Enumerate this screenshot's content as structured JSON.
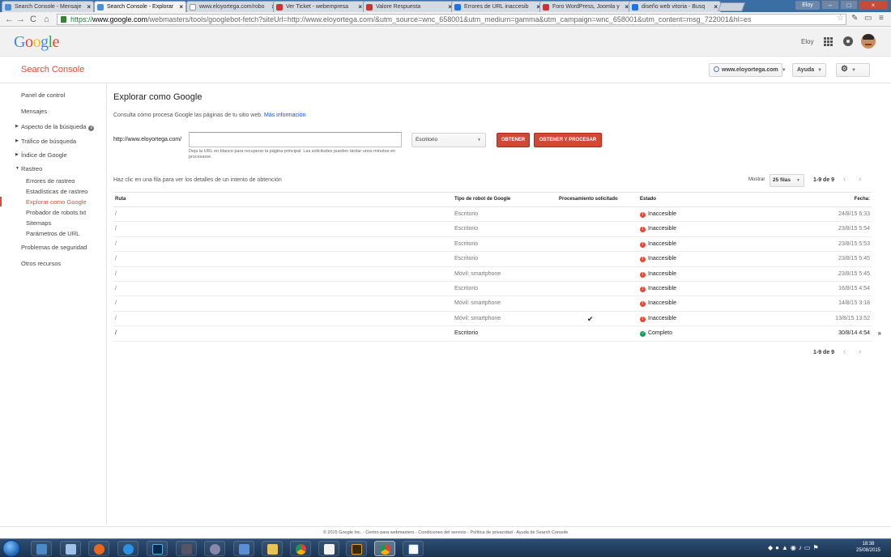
{
  "browser": {
    "tabs": [
      {
        "label": "Search Console - Mensaje"
      },
      {
        "label": "Search Console - Explorar"
      },
      {
        "label": "www.eloyortega.com/robo"
      },
      {
        "label": "Ver Ticket - webempresa"
      },
      {
        "label": "Valore Respuesta"
      },
      {
        "label": "Errores de URL inaccesib"
      },
      {
        "label": "Foro WordPress, Joomla y"
      },
      {
        "label": "diseño web vitoria - Busq"
      }
    ],
    "user_chip": "Eloy",
    "url": {
      "scheme": "https://",
      "host": "www.google.com",
      "path": "/webmasters/tools/googlebot-fetch?siteUrl=http://www.eloyortega.com/&utm_source=wnc_658001&utm_medium=gamma&utm_campaign=wnc_658001&utm_content=msg_722001&hl=es"
    }
  },
  "header": {
    "logo": "Google",
    "logo_colors": [
      "#4285f4",
      "#ea4335",
      "#fbbc05",
      "#4285f4",
      "#34a853",
      "#ea4335"
    ],
    "user_name": "Eloy"
  },
  "scbar": {
    "title": "Search Console",
    "site": "www.eloyortega.com",
    "help": "Ayuda"
  },
  "sidebar": {
    "panel": "Panel de control",
    "messages": "Mensajes",
    "search_appearance": "Aspecto de la búsqueda",
    "search_traffic": "Tráfico de búsqueda",
    "google_index": "Índice de Google",
    "crawl": "Rastreo",
    "crawl_errors": "Errores de rastreo",
    "crawl_stats": "Estadísticas de rastreo",
    "fetch_as_google": "Explorar como Google",
    "robots_tester": "Probador de robots.txt",
    "sitemaps": "Sitemaps",
    "url_params": "Parámetros de URL",
    "security": "Problemas de seguridad",
    "other": "Otros recursos"
  },
  "main": {
    "title": "Explorar como Google",
    "description": "Consulta cómo procesa Google las páginas de tu sitio web.",
    "more_info": "Más información",
    "url_prefix": "http://www.eloyortega.com/",
    "url_value": "",
    "url_help": "Deja la URL en blanco para recuperar la página principal. Las solicitudes pueden tardar unos minutos en procesarse.",
    "device": "Escritorio",
    "fetch_button": "OBTENER",
    "fetch_render_button": "OBTENER Y PROCESAR",
    "click_hint": "Haz clic en una fila para ver los detalles de un intento de obtención",
    "show_label": "Mostrar",
    "rows_per_page": "25 filas",
    "pager": "1-9 de 9"
  },
  "table": {
    "headers": {
      "path": "Ruta",
      "robot": "Tipo de robot de Google",
      "processing": "Procesamiento solicitado",
      "status": "Estado",
      "date": "Fecha:"
    },
    "rows": [
      {
        "path": "/",
        "robot": "Escritorio",
        "status": "Inaccesible",
        "date": "24/8/15 6:33"
      },
      {
        "path": "/",
        "robot": "Escritorio",
        "status": "Inaccesible",
        "date": "23/8/15 5:54"
      },
      {
        "path": "/",
        "robot": "Escritorio",
        "status": "Inaccesible",
        "date": "23/8/15 5:53"
      },
      {
        "path": "/",
        "robot": "Escritorio",
        "status": "Inaccesible",
        "date": "23/8/15 5:45"
      },
      {
        "path": "/",
        "robot": "Móvil: smartphone",
        "status": "Inaccesible",
        "date": "23/8/15 5:45"
      },
      {
        "path": "/",
        "robot": "Escritorio",
        "status": "Inaccesible",
        "date": "16/8/15 4:54"
      },
      {
        "path": "/",
        "robot": "Móvil: smartphone",
        "status": "Inaccesible",
        "date": "14/8/15 3:18"
      },
      {
        "path": "/",
        "robot": "Móvil: smartphone",
        "status": "Inaccesible",
        "date": "13/8/15 13:52"
      },
      {
        "path": "/",
        "robot": "Escritorio",
        "status": "Completo",
        "date": "30/8/14 4:54"
      }
    ]
  },
  "footer": "© 2015 Google Inc. - Centro para webmasters - Condiciones del servicio - Política de privacidad - Ayuda de Search Console",
  "taskbar": {
    "time": "18:38",
    "date": "25/08/2015"
  },
  "colors": {
    "accent_red": "#dd4b39",
    "button_red": "#d14836",
    "link_blue": "#1155cc",
    "ok_green": "#0f9d58"
  }
}
